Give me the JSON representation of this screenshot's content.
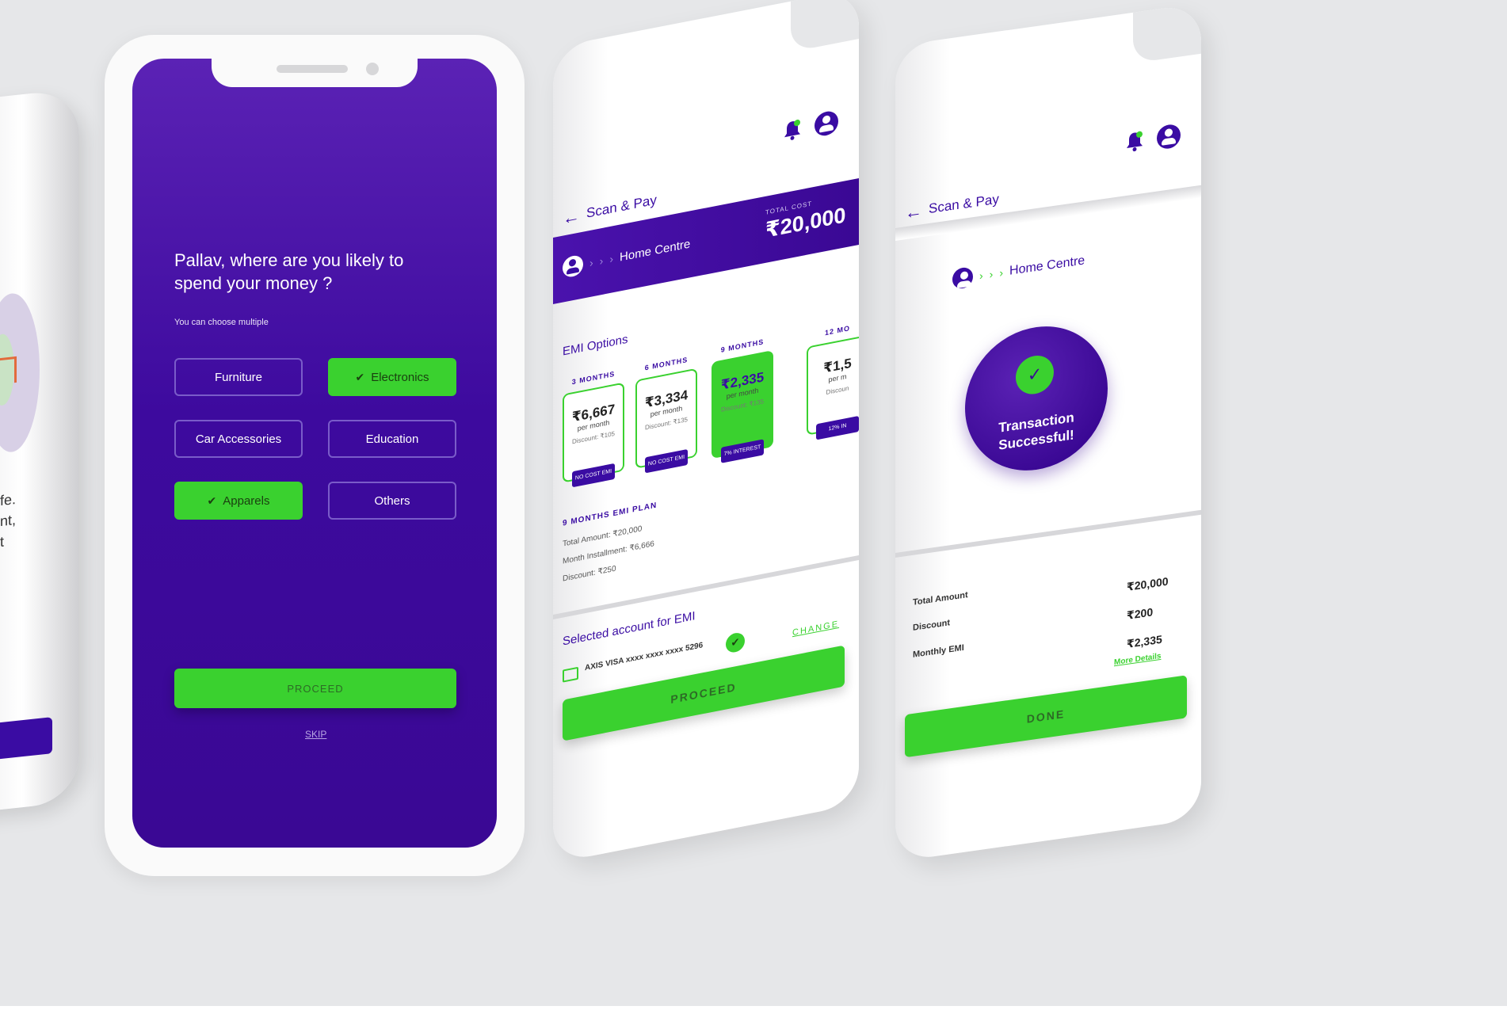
{
  "phone_onboarding_partial": {
    "text_fragments": [
      "fe.",
      "nt,",
      "t"
    ]
  },
  "phone_preferences": {
    "question": "Pallav, where are you likely to spend your money ?",
    "hint": "You can choose multiple",
    "options": [
      {
        "label": "Furniture",
        "selected": false
      },
      {
        "label": "Electronics",
        "selected": true
      },
      {
        "label": "Car Accessories",
        "selected": false
      },
      {
        "label": "Education",
        "selected": false
      },
      {
        "label": "Apparels",
        "selected": true
      },
      {
        "label": "Others",
        "selected": false
      }
    ],
    "proceed_label": "PROCEED",
    "skip_label": "SKIP"
  },
  "phone_emi": {
    "title": "Scan & Pay",
    "merchant": "Home Centre",
    "total_cost_label": "TOTAL COST",
    "total_cost": "₹20,000",
    "emi_options_label": "EMI Options",
    "plans": [
      {
        "months": "3 MONTHS",
        "amount": "₹6,667",
        "per": "per month",
        "discount": "Discount: ₹105",
        "tag": "NO COST EMI",
        "selected": false
      },
      {
        "months": "6 MONTHS",
        "amount": "₹3,334",
        "per": "per month",
        "discount": "Discount: ₹135",
        "tag": "NO COST EMI",
        "selected": false
      },
      {
        "months": "9 MONTHS",
        "amount": "₹2,335",
        "per": "per month",
        "discount": "Discount: ₹135",
        "tag": "7% INTEREST",
        "selected": true
      },
      {
        "months": "12 MO",
        "amount": "₹1,5",
        "per": "per m",
        "discount": "Discoun",
        "tag": "12% IN",
        "selected": false
      }
    ],
    "plan_title": "9 MONTHS EMI PLAN",
    "plan_lines": [
      "Total Amount: ₹20,000",
      "Month Installment: ₹6,666",
      "Discount: ₹250"
    ],
    "selected_account_label": "Selected account for EMI",
    "account": "AXIS VISA  xxxx xxxx xxxx 5296",
    "change_label": "CHANGE",
    "proceed_label": "PROCEED"
  },
  "phone_success": {
    "title": "Scan & Pay",
    "merchant": "Home Centre",
    "status_line1": "Transaction",
    "status_line2": "Successful!",
    "rows": [
      {
        "label": "Total Amount",
        "value": "₹20,000"
      },
      {
        "label": "Discount",
        "value": "₹200"
      },
      {
        "label": "Monthly EMI",
        "value": "₹2,335"
      }
    ],
    "more_details": "More Details",
    "done_label": "DONE"
  }
}
